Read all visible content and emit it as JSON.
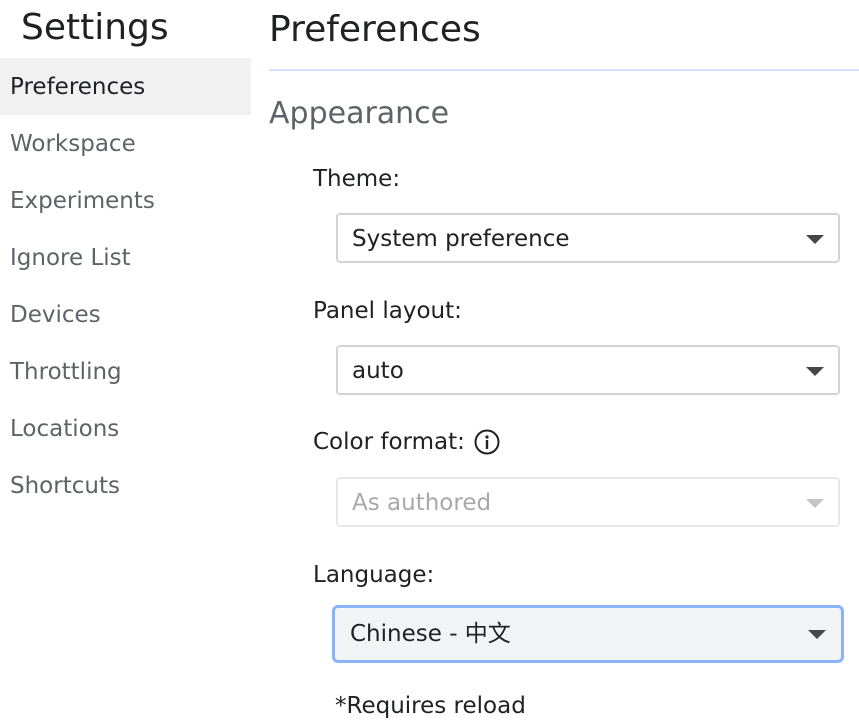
{
  "sidebar": {
    "title": "Settings",
    "items": [
      {
        "label": "Preferences",
        "selected": true
      },
      {
        "label": "Workspace",
        "selected": false
      },
      {
        "label": "Experiments",
        "selected": false
      },
      {
        "label": "Ignore List",
        "selected": false
      },
      {
        "label": "Devices",
        "selected": false
      },
      {
        "label": "Throttling",
        "selected": false
      },
      {
        "label": "Locations",
        "selected": false
      },
      {
        "label": "Shortcuts",
        "selected": false
      }
    ]
  },
  "main": {
    "title": "Preferences",
    "section": "Appearance",
    "theme": {
      "label": "Theme:",
      "value": "System preference"
    },
    "panel_layout": {
      "label": "Panel layout:",
      "value": "auto"
    },
    "color_format": {
      "label": "Color format:",
      "value": "As authored",
      "disabled": true,
      "icon": "info-icon"
    },
    "language": {
      "label": "Language:",
      "value": "Chinese - 中文",
      "focused": true
    },
    "note": "*Requires reload"
  },
  "colors": {
    "selected_nav_background": "#f1f1f1",
    "focus_ring": "#8ab4f8",
    "divider": "#d3e3fd",
    "secondary_text": "#5f6368"
  }
}
